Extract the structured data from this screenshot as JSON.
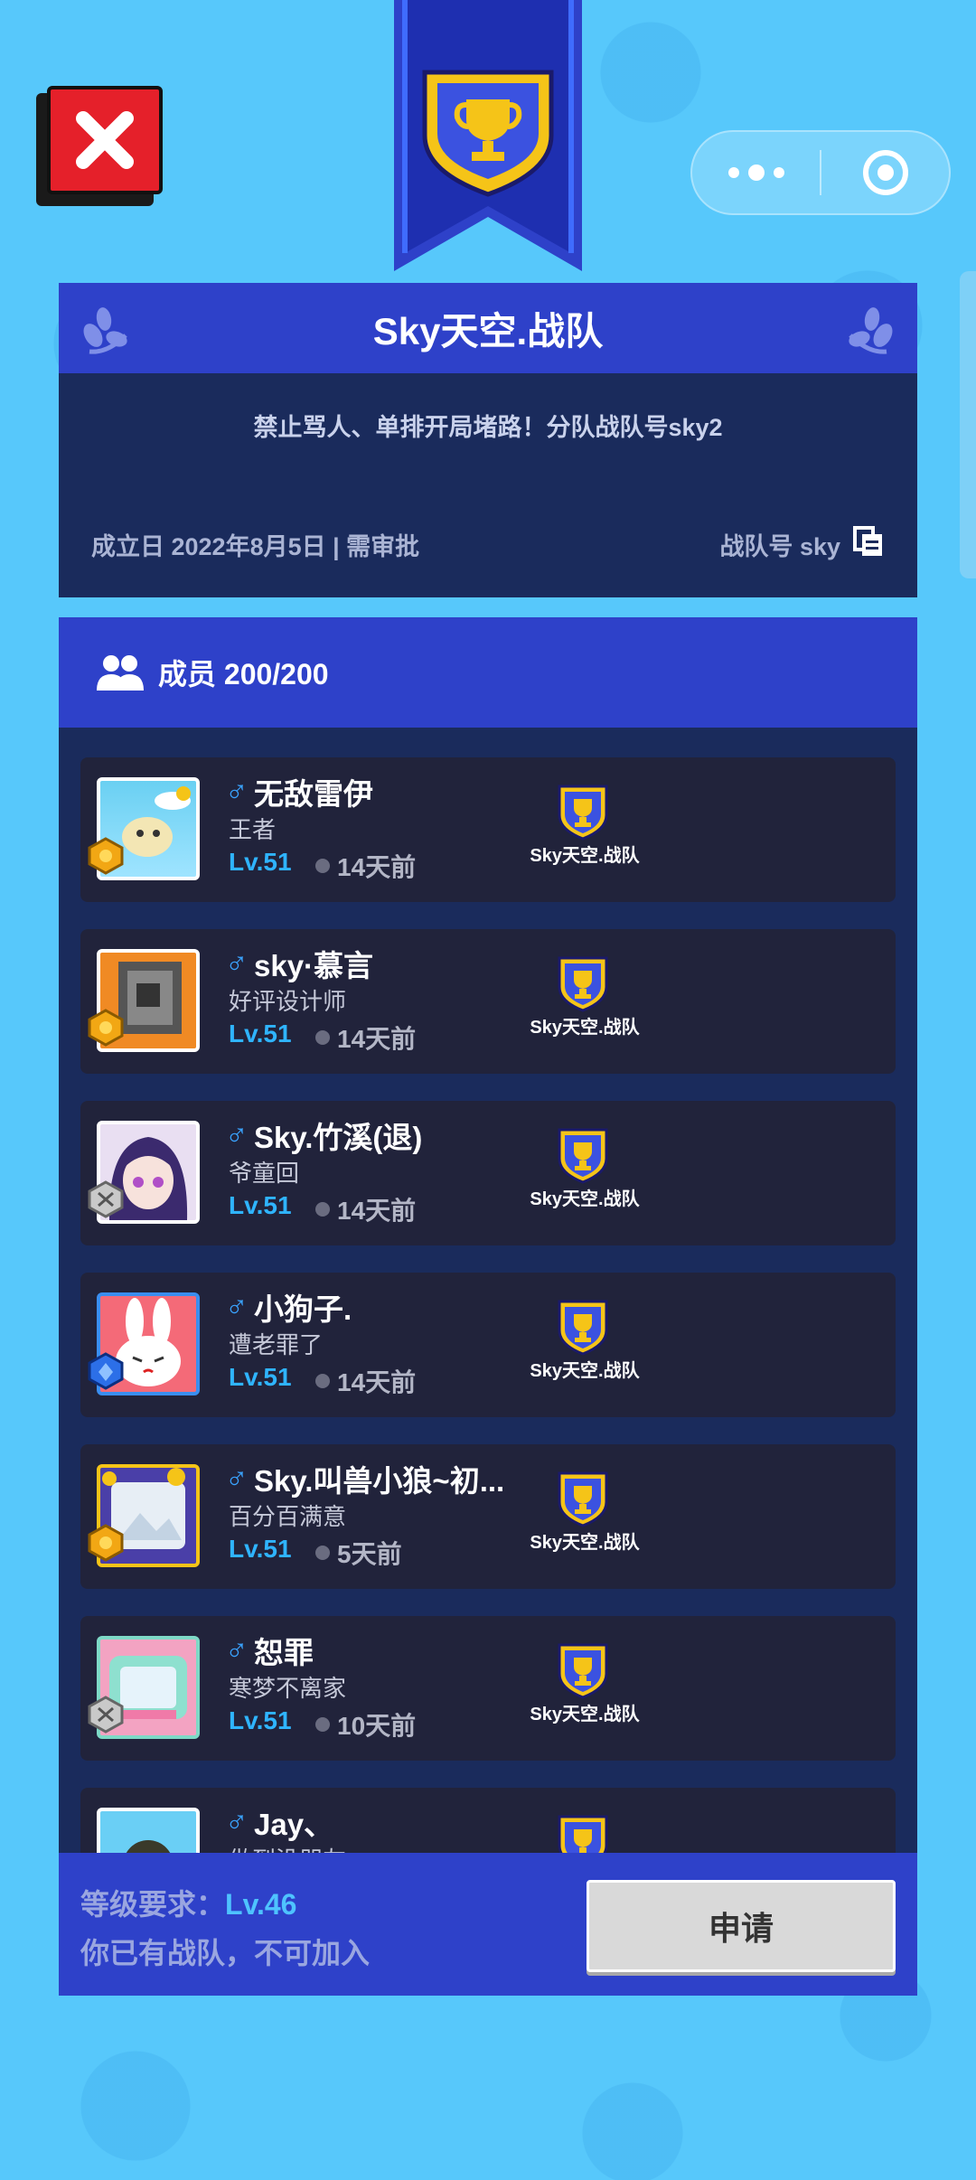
{
  "team": {
    "name": "Sky天空.战队",
    "motto": "禁止骂人、单排开局堵路！分队战队号sky2",
    "founded": "成立日 2022年8月5日 | 需审批",
    "team_id": "战队号 sky"
  },
  "members": {
    "header": "成员 200/200",
    "list": [
      {
        "gender": "♂",
        "name": "无敌雷伊",
        "title": "王者",
        "level": "Lv.51",
        "last_seen": "14天前",
        "team": "Sky天空.战队"
      },
      {
        "gender": "♂",
        "name": "sky·慕言",
        "title": "好评设计师",
        "level": "Lv.51",
        "last_seen": "14天前",
        "team": "Sky天空.战队"
      },
      {
        "gender": "♂",
        "name": "Sky.竹溪(退)",
        "title": "爷童回",
        "level": "Lv.51",
        "last_seen": "14天前",
        "team": "Sky天空.战队"
      },
      {
        "gender": "♂",
        "name": "小狗子.",
        "title": "遭老罪了",
        "level": "Lv.51",
        "last_seen": "14天前",
        "team": "Sky天空.战队"
      },
      {
        "gender": "♂",
        "name": "Sky.叫兽小狼~初...",
        "title": "百分百满意",
        "level": "Lv.51",
        "last_seen": "5天前",
        "team": "Sky天空.战队"
      },
      {
        "gender": "♂",
        "name": "恕罪",
        "title": "寒梦不离家",
        "level": "Lv.51",
        "last_seen": "10天前",
        "team": "Sky天空.战队"
      },
      {
        "gender": "♂",
        "name": "Jay、",
        "title": "做到没朋友",
        "level": "",
        "last_seen": "",
        "team": ""
      }
    ]
  },
  "footer": {
    "req_label": "等级要求：",
    "req_level": "Lv.46",
    "status": "你已有战队，不可加入",
    "apply_label": "申请"
  },
  "icons": {
    "close": "close-icon",
    "trophy": "trophy-icon",
    "more": "more-dots-icon",
    "target": "target-icon",
    "laurel": "laurel-icon",
    "members": "members-icon",
    "copy": "copy-icon"
  },
  "colors": {
    "background": "#57c8fb",
    "header_blue": "#2e41c9",
    "panel_navy": "#1a2b5c",
    "card_dark": "#21233b",
    "level_blue": "#2fb4ff",
    "close_red": "#e5202a"
  }
}
